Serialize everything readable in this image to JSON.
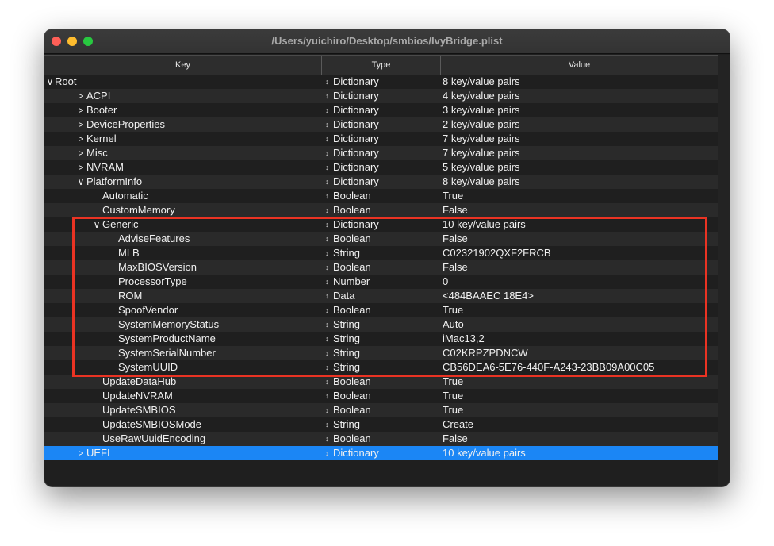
{
  "window": {
    "title": "/Users/yuichiro/Desktop/smbios/IvyBridge.plist"
  },
  "header": {
    "key": "Key",
    "type": "Type",
    "value": "Value"
  },
  "colors": {
    "selection": "#1b86f5",
    "highlight_box": "#ea3323"
  },
  "rows": [
    {
      "level": 0,
      "disclosure": "open",
      "key": "Root",
      "type": "Dictionary",
      "value": "8 key/value pairs"
    },
    {
      "level": 1,
      "disclosure": "closed",
      "key": "ACPI",
      "type": "Dictionary",
      "value": "4 key/value pairs"
    },
    {
      "level": 1,
      "disclosure": "closed",
      "key": "Booter",
      "type": "Dictionary",
      "value": "3 key/value pairs"
    },
    {
      "level": 1,
      "disclosure": "closed",
      "key": "DeviceProperties",
      "type": "Dictionary",
      "value": "2 key/value pairs"
    },
    {
      "level": 1,
      "disclosure": "closed",
      "key": "Kernel",
      "type": "Dictionary",
      "value": "7 key/value pairs"
    },
    {
      "level": 1,
      "disclosure": "closed",
      "key": "Misc",
      "type": "Dictionary",
      "value": "7 key/value pairs"
    },
    {
      "level": 1,
      "disclosure": "closed",
      "key": "NVRAM",
      "type": "Dictionary",
      "value": "5 key/value pairs"
    },
    {
      "level": 1,
      "disclosure": "open",
      "key": "PlatformInfo",
      "type": "Dictionary",
      "value": "8 key/value pairs"
    },
    {
      "level": 2,
      "disclosure": "none",
      "key": "Automatic",
      "type": "Boolean",
      "value": "True"
    },
    {
      "level": 2,
      "disclosure": "none",
      "key": "CustomMemory",
      "type": "Boolean",
      "value": "False"
    },
    {
      "level": 2,
      "disclosure": "open",
      "key": "Generic",
      "type": "Dictionary",
      "value": "10 key/value pairs"
    },
    {
      "level": 3,
      "disclosure": "none",
      "key": "AdviseFeatures",
      "type": "Boolean",
      "value": "False"
    },
    {
      "level": 3,
      "disclosure": "none",
      "key": "MLB",
      "type": "String",
      "value": "C02321902QXF2FRCB"
    },
    {
      "level": 3,
      "disclosure": "none",
      "key": "MaxBIOSVersion",
      "type": "Boolean",
      "value": "False"
    },
    {
      "level": 3,
      "disclosure": "none",
      "key": "ProcessorType",
      "type": "Number",
      "value": "0"
    },
    {
      "level": 3,
      "disclosure": "none",
      "key": "ROM",
      "type": "Data",
      "value": "<484BAAEC 18E4>"
    },
    {
      "level": 3,
      "disclosure": "none",
      "key": "SpoofVendor",
      "type": "Boolean",
      "value": "True"
    },
    {
      "level": 3,
      "disclosure": "none",
      "key": "SystemMemoryStatus",
      "type": "String",
      "value": "Auto"
    },
    {
      "level": 3,
      "disclosure": "none",
      "key": "SystemProductName",
      "type": "String",
      "value": "iMac13,2"
    },
    {
      "level": 3,
      "disclosure": "none",
      "key": "SystemSerialNumber",
      "type": "String",
      "value": "C02KRPZPDNCW"
    },
    {
      "level": 3,
      "disclosure": "none",
      "key": "SystemUUID",
      "type": "String",
      "value": "CB56DEA6-5E76-440F-A243-23BB09A00C05"
    },
    {
      "level": 2,
      "disclosure": "none",
      "key": "UpdateDataHub",
      "type": "Boolean",
      "value": "True"
    },
    {
      "level": 2,
      "disclosure": "none",
      "key": "UpdateNVRAM",
      "type": "Boolean",
      "value": "True"
    },
    {
      "level": 2,
      "disclosure": "none",
      "key": "UpdateSMBIOS",
      "type": "Boolean",
      "value": "True"
    },
    {
      "level": 2,
      "disclosure": "none",
      "key": "UpdateSMBIOSMode",
      "type": "String",
      "value": "Create"
    },
    {
      "level": 2,
      "disclosure": "none",
      "key": "UseRawUuidEncoding",
      "type": "Boolean",
      "value": "False"
    },
    {
      "level": 1,
      "disclosure": "closed",
      "key": "UEFI",
      "type": "Dictionary",
      "value": "10 key/value pairs",
      "selected": true
    }
  ]
}
